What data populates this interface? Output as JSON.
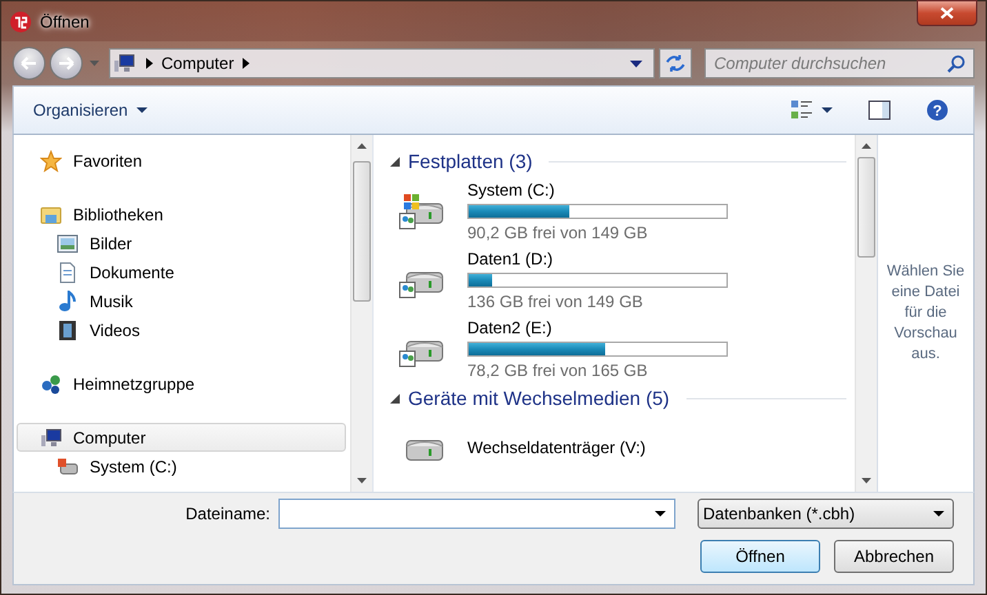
{
  "window": {
    "title": "Öffnen"
  },
  "address_bar": {
    "path": [
      "Computer"
    ]
  },
  "search": {
    "placeholder": "Computer durchsuchen"
  },
  "toolbar": {
    "organize": "Organisieren",
    "help": "?"
  },
  "sidebar": {
    "items": [
      {
        "label": "Favoriten",
        "kind": "favorites",
        "selected": false
      },
      {
        "label": "Bibliotheken",
        "kind": "libraries",
        "selected": false,
        "children": [
          {
            "label": "Bilder",
            "kind": "pictures",
            "selected": false
          },
          {
            "label": "Dokumente",
            "kind": "documents",
            "selected": false
          },
          {
            "label": "Musik",
            "kind": "music",
            "selected": false
          },
          {
            "label": "Videos",
            "kind": "videos",
            "selected": false
          }
        ]
      },
      {
        "label": "Heimnetzgruppe",
        "kind": "homegroup",
        "selected": false
      },
      {
        "label": "Computer",
        "kind": "computer",
        "selected": true,
        "children": [
          {
            "label": "System (C:)",
            "kind": "drive",
            "selected": false
          }
        ]
      }
    ]
  },
  "sections": [
    {
      "title": "Festplatten (3)",
      "expanded": true,
      "drives": [
        {
          "name": "System (C:)",
          "kind": "system",
          "level": 0.39,
          "free": "90,2 GB frei von 149 GB"
        },
        {
          "name": "Daten1 (D:)",
          "kind": "data",
          "level": 0.09,
          "free": "136 GB frei von 149 GB"
        },
        {
          "name": "Daten2 (E:)",
          "kind": "data",
          "level": 0.53,
          "free": "78,2 GB frei von 165 GB"
        }
      ]
    },
    {
      "title": "Geräte mit Wechselmedien (5)",
      "expanded": true,
      "drives": [
        {
          "name": "Wechseldatenträger (V:)",
          "kind": "removable"
        }
      ]
    }
  ],
  "preview": {
    "message": "Wählen Sie eine Datei für die Vorschau aus."
  },
  "filename": {
    "label": "Dateiname:"
  },
  "filter": {
    "value": "Datenbanken (*.cbh)"
  },
  "buttons": [
    {
      "label": "Öffnen",
      "default": true
    },
    {
      "label": "Abbrechen",
      "default": false
    }
  ]
}
